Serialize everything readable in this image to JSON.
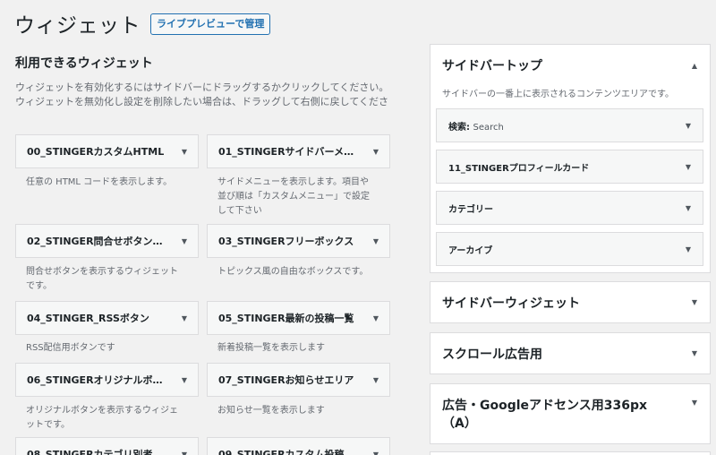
{
  "header": {
    "title": "ウィジェット",
    "live_preview_button": "ライブプレビューで管理"
  },
  "available": {
    "title": "利用できるウィジェット",
    "desc_line1": "ウィジェットを有効化するにはサイドバーにドラッグするかクリックしてください。",
    "desc_line2": "ウィジェットを無効化し設定を削除したい場合は、ドラッグして右側に戻してくださ",
    "widgets": [
      {
        "name": "00_STINGERカスタムHTML",
        "desc": "任意の HTML コードを表示します。"
      },
      {
        "name": "01_STINGERサイドバーメ…",
        "desc": "サイドメニューを表示します。項目や並び順は「カスタムメニュー」で設定して下さい"
      },
      {
        "name": "02_STINGER問合せボタン…",
        "desc": "問合せボタンを表示するウィジェットです。"
      },
      {
        "name": "03_STINGERフリーボックス",
        "desc": "トピックス風の自由なボックスです。"
      },
      {
        "name": "04_STINGER_RSSボタン",
        "desc": "RSS配信用ボタンです"
      },
      {
        "name": "05_STINGER最新の投稿一覧",
        "desc": "新着投稿一覧を表示します"
      },
      {
        "name": "06_STINGERオリジナルボ…",
        "desc": "オリジナルボタンを表示するウィジェットです。"
      },
      {
        "name": "07_STINGERお知らせエリア",
        "desc": "お知らせ一覧を表示します"
      },
      {
        "name": "08_STINGERカテゴリ別考…",
        "desc": ""
      },
      {
        "name": "09_STINGERカスタム投稿…",
        "desc": ""
      }
    ]
  },
  "sidebar_top": {
    "title": "サイドバートップ",
    "desc": "サイドバーの一番上に表示されるコンテンツエリアです。",
    "widgets": [
      {
        "name": "検索:",
        "sub": "Search"
      },
      {
        "name": "11_STINGERプロフィールカード",
        "sub": ""
      },
      {
        "name": "カテゴリー",
        "sub": ""
      },
      {
        "name": "アーカイブ",
        "sub": ""
      }
    ]
  },
  "areas": [
    {
      "title": "サイドバーウィジェット"
    },
    {
      "title": "スクロール広告用"
    },
    {
      "title": "広告・Googleアドセンス用336px",
      "title2": "（A）"
    }
  ],
  "icons": {
    "toggle": "triangle-down-icon",
    "collapse": "triangle-up-icon"
  }
}
